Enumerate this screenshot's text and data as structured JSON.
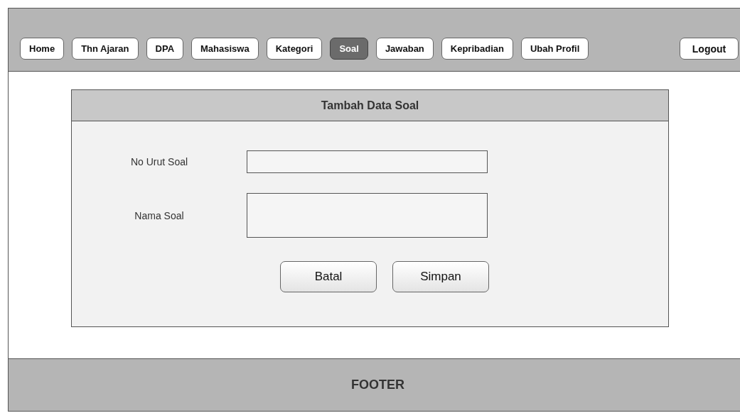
{
  "nav": [
    {
      "label": "Home",
      "selected": false
    },
    {
      "label": "Thn Ajaran",
      "selected": false
    },
    {
      "label": "DPA",
      "selected": false
    },
    {
      "label": "Mahasiswa",
      "selected": false
    },
    {
      "label": "Kategori",
      "selected": false
    },
    {
      "label": "Soal",
      "selected": true
    },
    {
      "label": "Jawaban",
      "selected": false
    },
    {
      "label": "Kepribadian",
      "selected": false
    },
    {
      "label": "Ubah Profil",
      "selected": false
    }
  ],
  "logout": "Logout",
  "panel": {
    "title": "Tambah Data Soal",
    "fields": [
      {
        "label": "No Urut Soal",
        "kind": "input"
      },
      {
        "label": "Nama Soal",
        "kind": "textarea"
      }
    ],
    "buttons": [
      "Batal",
      "Simpan"
    ]
  },
  "footer": "FOOTER"
}
